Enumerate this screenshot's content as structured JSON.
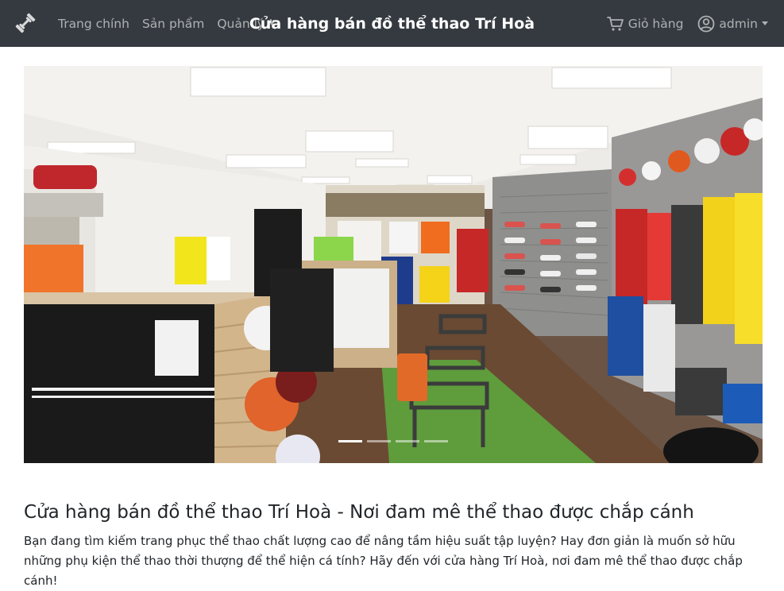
{
  "navbar": {
    "brand_icon": "dumbbell-icon",
    "links": [
      {
        "label": "Trang chính"
      },
      {
        "label": "Sản phẩm"
      },
      {
        "label": "Quản lý",
        "dropdown": true
      }
    ],
    "title": "Cửa hàng bán đồ thể thao Trí Hoà",
    "cart": {
      "label": "Giỏ hàng",
      "icon": "cart-icon"
    },
    "user": {
      "label": "admin",
      "icon": "user-circle-icon",
      "dropdown": true
    },
    "colors": {
      "background": "#343a40",
      "link": "rgba(255,255,255,0.6)",
      "title": "#ffffff"
    }
  },
  "carousel": {
    "slide_count": 4,
    "active_index": 0,
    "image_subject": "sports store interior"
  },
  "content": {
    "heading": "Cửa hàng bán đồ thể thao Trí Hoà - Nơi đam mê thể thao được chắp cánh",
    "paragraph": "Bạn đang tìm kiếm trang phục thể thao chất lượng cao để nâng tầm hiệu suất tập luyện? Hay đơn giản là muốn sở hữu những phụ kiện thể thao thời thượng để thể hiện cá tính? Hãy đến với cửa hàng Trí Hoà, nơi đam mê thể thao được chắp cánh!"
  }
}
